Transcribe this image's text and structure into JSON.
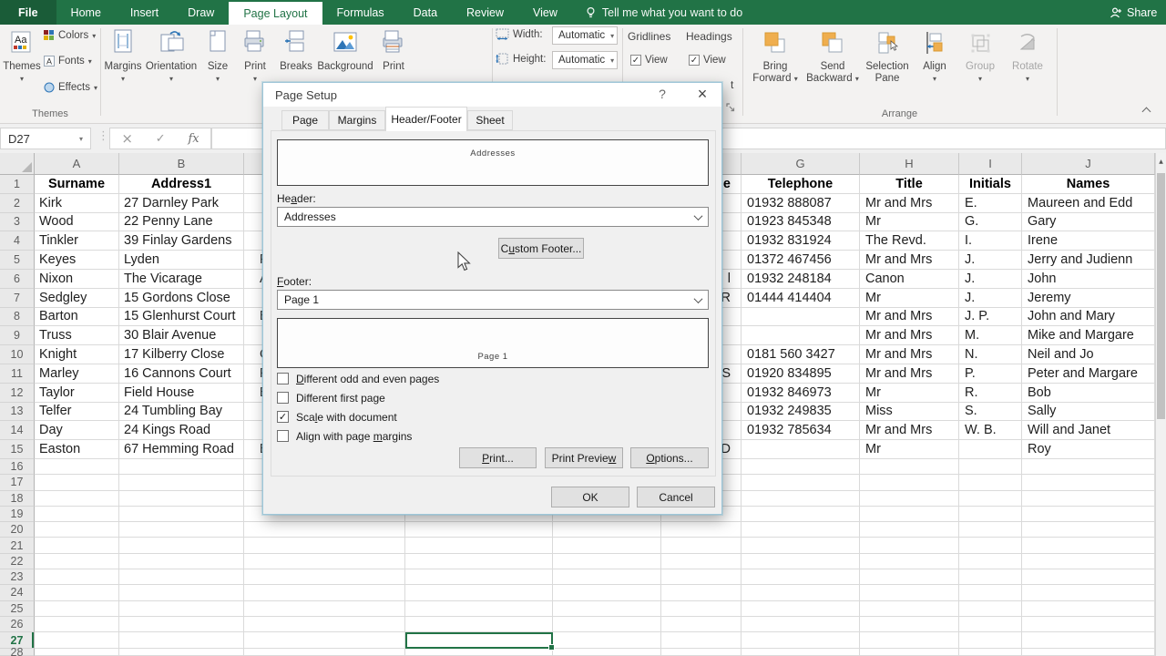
{
  "ribbon": {
    "tabs": [
      {
        "label": "File"
      },
      {
        "label": "Home"
      },
      {
        "label": "Insert"
      },
      {
        "label": "Draw"
      },
      {
        "label": "Page Layout",
        "active": true
      },
      {
        "label": "Formulas"
      },
      {
        "label": "Data"
      },
      {
        "label": "Review"
      },
      {
        "label": "View"
      }
    ],
    "tell_me": "Tell me what you want to do",
    "share_label": "Share",
    "themes_group": {
      "label": "Themes",
      "themes_button": "Themes",
      "colors": "Colors",
      "fonts": "Fonts",
      "effects": "Effects"
    },
    "page_setup_group": {
      "buttons": [
        {
          "label": "Margins",
          "arrow": true
        },
        {
          "label": "Orientation",
          "arrow": true
        },
        {
          "label": "Size",
          "arrow": true
        },
        {
          "label": "Print",
          "arrow": true
        },
        {
          "label": "Breaks"
        },
        {
          "label": "Background"
        },
        {
          "label": "Print"
        }
      ]
    },
    "scale_group": {
      "width_label": "Width:",
      "width_value": "Automatic",
      "height_label": "Height:",
      "height_value": "Automatic"
    },
    "sheet_options_group": {
      "gridlines_label": "Gridlines",
      "headings_label": "Headings",
      "gridlines_view": "View",
      "headings_view": "View",
      "print_fragment": "t"
    },
    "arrange_group": {
      "label": "Arrange",
      "buttons": [
        {
          "line1": "Bring",
          "line2": "Forward",
          "arrow": true
        },
        {
          "line1": "Send",
          "line2": "Backward",
          "arrow": true
        },
        {
          "line1": "Selection",
          "line2": "Pane"
        },
        {
          "line1": "Align",
          "arrow": true
        },
        {
          "line1": "Group",
          "disabled": true
        },
        {
          "line1": "Rotate",
          "disabled": true
        }
      ]
    }
  },
  "formula_bar": {
    "name_box": "D27"
  },
  "dialog": {
    "title": "Page Setup",
    "help_icon": "?",
    "close_icon": "×",
    "tabs": [
      {
        "label": "Page"
      },
      {
        "label": "Margins"
      },
      {
        "label": "Header/Footer",
        "active": true
      },
      {
        "label": "Sheet"
      }
    ],
    "header_preview_text": "Addresses",
    "header_label": "Header:",
    "header_value": "Addresses",
    "custom_footer_label": "Custom Footer...",
    "footer_label": "Footer:",
    "footer_value": "Page 1",
    "footer_preview_text": "Page 1",
    "checkboxes": [
      {
        "label": "Different odd and even pages",
        "glyph": ""
      },
      {
        "label": "Different first page",
        "glyph": ""
      },
      {
        "label": "Scale with document",
        "glyph": "✓"
      },
      {
        "label": "Align with page margins",
        "glyph": ""
      }
    ],
    "print_button": "Print...",
    "print_preview_button": "Print Preview",
    "options_button": "Options...",
    "ok_button": "OK",
    "cancel_button": "Cancel"
  },
  "sheet": {
    "column_letters": [
      "A",
      "B",
      "C",
      "D",
      "E",
      "F",
      "G",
      "H",
      "I",
      "J"
    ],
    "rows": [
      {
        "n": "1",
        "A": "Surname",
        "B": "Address1",
        "F": "e",
        "G": "Telephone",
        "H": "Title",
        "I": "Initials",
        "J": "Names",
        "header": true
      },
      {
        "n": "2",
        "A": "Kirk",
        "B": "27 Darnley Park",
        "G": "01932 888087",
        "H": "Mr and Mrs",
        "I": "E.",
        "J": "Maureen and Edd"
      },
      {
        "n": "3",
        "A": "Wood",
        "B": "22 Penny Lane",
        "G": "01923 845348",
        "H": "Mr",
        "I": "G.",
        "J": "Gary"
      },
      {
        "n": "4",
        "A": "Tinkler",
        "B": "39 Finlay Gardens",
        "G": "01932 831924",
        "H": "The Revd.",
        "I": "I.",
        "J": "Irene"
      },
      {
        "n": "5",
        "A": "Keyes",
        "B": "Lyden",
        "C": "F",
        "G": "01372 467456",
        "H": "Mr and Mrs",
        "I": "J.",
        "J": "Jerry and Judienn"
      },
      {
        "n": "6",
        "A": "Nixon",
        "B": "The Vicarage",
        "C": "A",
        "F": "l",
        "G": "01932 248184",
        "H": "Canon",
        "I": "J.",
        "J": "John"
      },
      {
        "n": "7",
        "A": "Sedgley",
        "B": "15 Gordons Close",
        "F": "R",
        "G": "01444 414404",
        "H": "Mr",
        "I": "J.",
        "J": "Jeremy"
      },
      {
        "n": "8",
        "A": "Barton",
        "B": "15 Glenhurst Court",
        "C": "E",
        "H": "Mr and Mrs",
        "I": "J. P.",
        "J": "John and Mary"
      },
      {
        "n": "9",
        "A": "Truss",
        "B": "30 Blair Avenue",
        "H": "Mr and Mrs",
        "I": "M.",
        "J": "Mike and Margare"
      },
      {
        "n": "10",
        "A": "Knight",
        "B": "17 Kilberry Close",
        "C": "C",
        "G": "0181 560 3427",
        "H": "Mr and Mrs",
        "I": "N.",
        "J": "Neil and Jo"
      },
      {
        "n": "11",
        "A": "Marley",
        "B": "16 Cannons Court",
        "C": "F",
        "F": "S",
        "G": "01920 834895",
        "H": "Mr and Mrs",
        "I": "P.",
        "J": "Peter and Margare"
      },
      {
        "n": "12",
        "A": "Taylor",
        "B": "Field House",
        "C": "E",
        "G": "01932 846973",
        "H": "Mr",
        "I": "R.",
        "J": "Bob"
      },
      {
        "n": "13",
        "A": "Telfer",
        "B": "24 Tumbling Bay",
        "G": "01932 249835",
        "H": "Miss",
        "I": "S.",
        "J": "Sally"
      },
      {
        "n": "14",
        "A": "Day",
        "B": "24 Kings Road",
        "G": "01932 785634",
        "H": "Mr and Mrs",
        "I": "W. B.",
        "J": "Will and Janet"
      },
      {
        "n": "15",
        "A": "Easton",
        "B": "67 Hemming Road",
        "C": "E",
        "F": "D",
        "H": "Mr",
        "J": "Roy"
      }
    ],
    "selection": {
      "cell": "D27",
      "row": "27"
    },
    "last_row_number": "28"
  },
  "icons": {
    "dropdown_arrow": "▾",
    "checkmark": "✓",
    "cancel_x": "×",
    "scroll_up": "▲",
    "dots": "⋮",
    "fx": "fx"
  },
  "colors": {
    "excel_green": "#217346",
    "selection_green": "#217346",
    "arrange_orange": "#efae4e",
    "icon_blue": "#2e75b6"
  }
}
